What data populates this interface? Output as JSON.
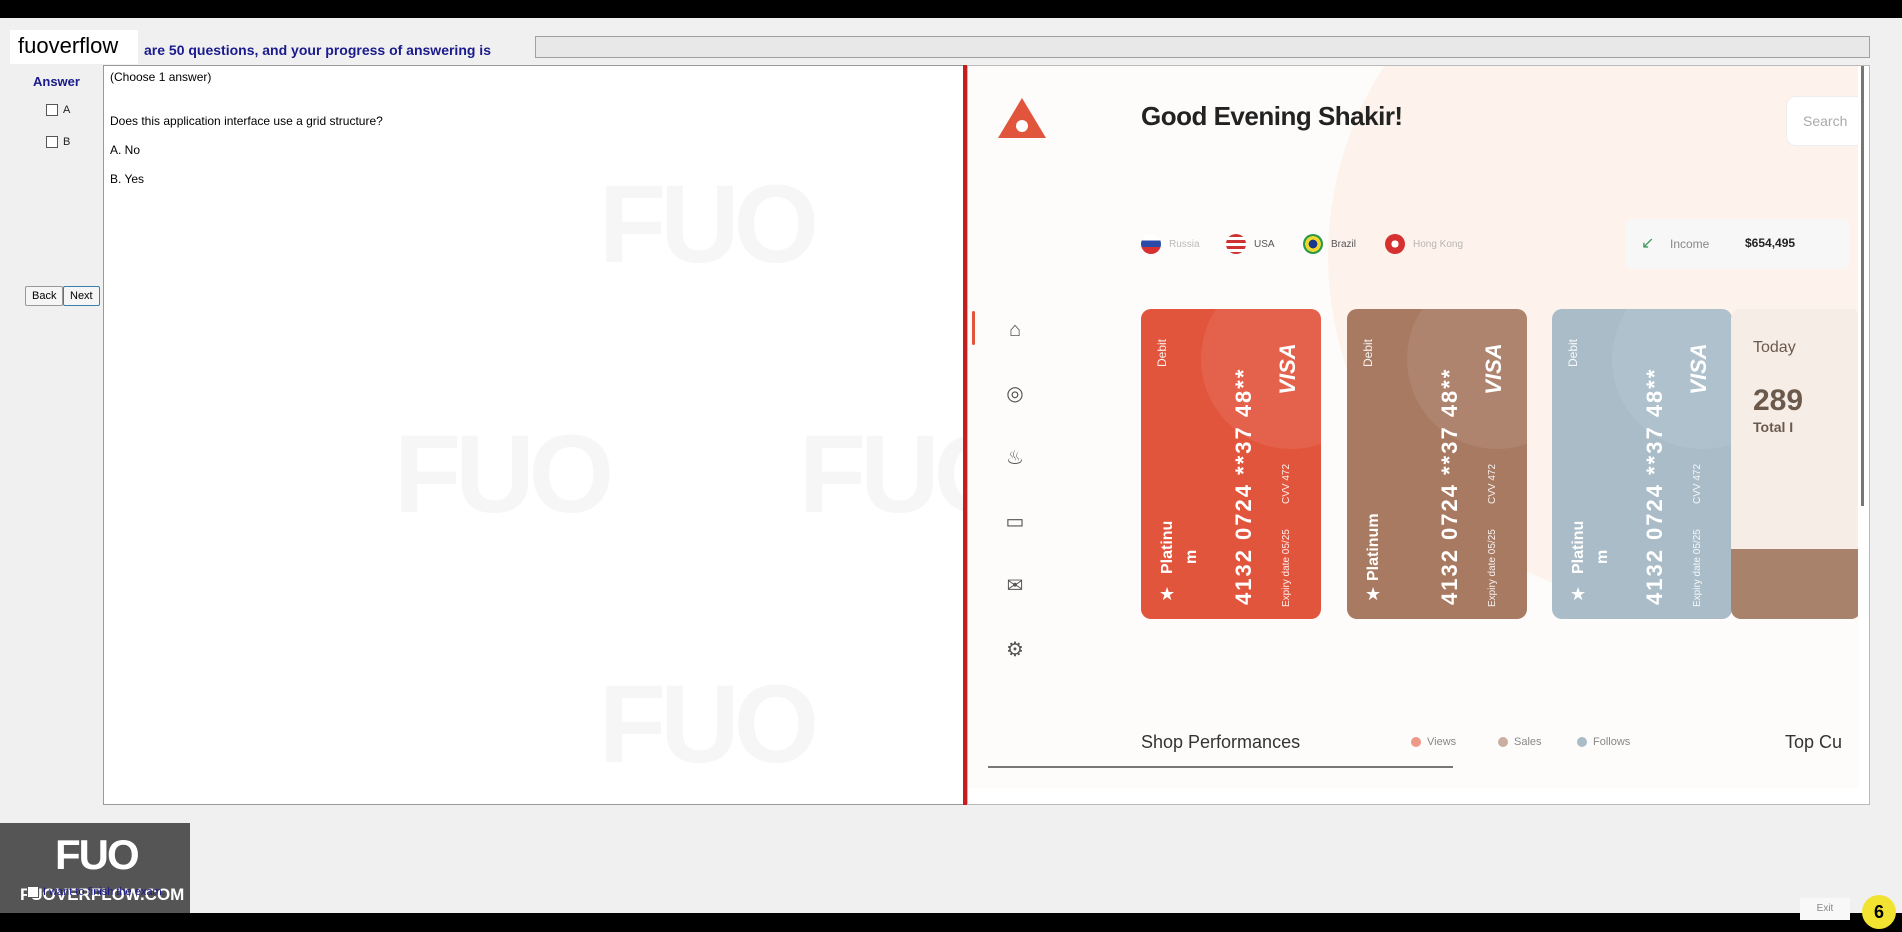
{
  "header": {
    "brand": "fuoverflow",
    "progress_text": "are 50 questions, and your progress of answering is",
    "progress_value": 0
  },
  "answer_panel": {
    "title": "Answer",
    "options": [
      "A",
      "B"
    ],
    "back_label": "Back",
    "next_label": "Next"
  },
  "question": {
    "instruction": "(Choose 1 answer)",
    "text": "Does this application interface use a grid structure?",
    "answers": [
      "A.  No",
      "B.  Yes"
    ]
  },
  "screenshot": {
    "greeting": "Good Evening Shakir!",
    "search_placeholder": "Search",
    "countries": [
      "Russia",
      "USA",
      "Brazil",
      "Hong Kong"
    ],
    "income_label": "Income",
    "income_value": "$654,495",
    "cards": [
      {
        "type": "Debit",
        "brand": "VISA",
        "tier": "Platinu",
        "tier_suffix": "m",
        "number": "4132 0724 **37 48**",
        "cvv": "CVV 472",
        "expiry": "Expiry date 05/25",
        "color": "#e2553d"
      },
      {
        "type": "Debit",
        "brand": "VISA",
        "tier": "Platinum",
        "tier_suffix": "",
        "number": "4132 0724 **37 48**",
        "cvv": "CVV 472",
        "expiry": "Expiry date 05/25",
        "color": "#a87a62"
      },
      {
        "type": "Debit",
        "brand": "VISA",
        "tier": "Platinu",
        "tier_suffix": "m",
        "number": "4132 0724 **37 48**",
        "cvv": "CVV 472",
        "expiry": "Expiry date 05/25",
        "color": "#a9bcc8"
      }
    ],
    "today_label": "Today",
    "today_value": "289",
    "total_label": "Total I",
    "shop_title": "Shop Performances",
    "legend": [
      "Views",
      "Sales",
      "Follows"
    ],
    "top_customers": "Top Cu",
    "watermark": "FUOVERFLOW.COM"
  },
  "footer": {
    "logo": "FUO",
    "logo_site": "FUOVERFLOW.COM",
    "finish_label": "I want to finish the exam.",
    "exit_label": "Exit",
    "badge": "6"
  }
}
